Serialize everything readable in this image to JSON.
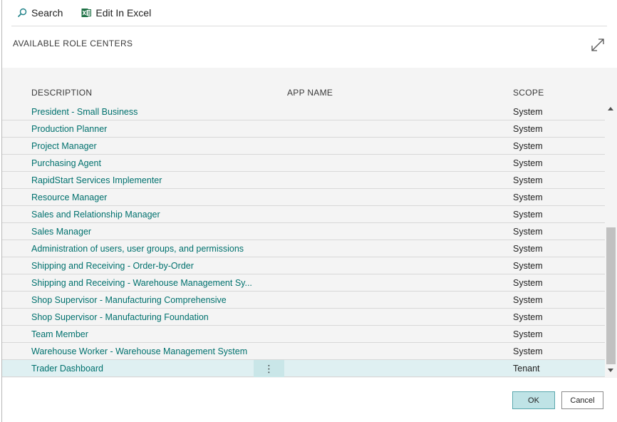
{
  "toolbar": {
    "search_label": "Search",
    "excel_label": "Edit In Excel"
  },
  "dialog": {
    "title": "AVAILABLE ROLE CENTERS"
  },
  "grid": {
    "columns": {
      "description": "DESCRIPTION",
      "app_name": "APP NAME",
      "scope": "SCOPE"
    },
    "rows": [
      {
        "description": "President - Small Business",
        "app_name": "",
        "scope": "System"
      },
      {
        "description": "Production Planner",
        "app_name": "",
        "scope": "System"
      },
      {
        "description": "Project Manager",
        "app_name": "",
        "scope": "System"
      },
      {
        "description": "Purchasing Agent",
        "app_name": "",
        "scope": "System"
      },
      {
        "description": "RapidStart Services Implementer",
        "app_name": "",
        "scope": "System"
      },
      {
        "description": "Resource Manager",
        "app_name": "",
        "scope": "System"
      },
      {
        "description": "Sales and Relationship Manager",
        "app_name": "",
        "scope": "System"
      },
      {
        "description": "Sales Manager",
        "app_name": "",
        "scope": "System"
      },
      {
        "description": "Administration of users, user groups, and permissions",
        "app_name": "",
        "scope": "System"
      },
      {
        "description": "Shipping and Receiving - Order-by-Order",
        "app_name": "",
        "scope": "System"
      },
      {
        "description": "Shipping and Receiving - Warehouse Management Sy...",
        "app_name": "",
        "scope": "System"
      },
      {
        "description": "Shop Supervisor - Manufacturing Comprehensive",
        "app_name": "",
        "scope": "System"
      },
      {
        "description": "Shop Supervisor - Manufacturing Foundation",
        "app_name": "",
        "scope": "System"
      },
      {
        "description": "Team Member",
        "app_name": "",
        "scope": "System"
      },
      {
        "description": "Warehouse Worker - Warehouse Management System",
        "app_name": "",
        "scope": "System"
      },
      {
        "description": "Trader Dashboard",
        "app_name": "",
        "scope": "Tenant",
        "selected": true
      }
    ],
    "row_menu_glyph": "⋮"
  },
  "buttons": {
    "ok": "OK",
    "cancel": "Cancel"
  },
  "colors": {
    "link": "#00716e",
    "selected_row": "#dff0f2",
    "ok_button": "#bfe3e6",
    "excel_green": "#1e7145"
  }
}
